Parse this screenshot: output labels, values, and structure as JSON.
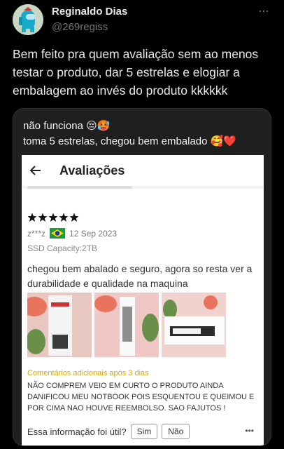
{
  "tweet": {
    "author_name": "Reginaldo Dias",
    "handle": "@269regiss",
    "more_icon": "⋯",
    "text": "Bem feito pra quem avaliação sem ao menos testar o produto, dar 5 estrelas e elogiar a embalagem ao invés do produto kkkkkk"
  },
  "caption": {
    "line1": "não funciona 😔🥵",
    "line2": "toma 5 estrelas, chegou bem embalado 🥰❤️"
  },
  "app": {
    "title": "Avaliações",
    "back_icon": "arrow-left-icon"
  },
  "review": {
    "rating": 5,
    "reviewer": "z***z",
    "date": "12 Sep 2023",
    "capacity": "SSD Capacity:2TB",
    "text": "chegou bem abalado e seguro, agora so resta ver a durabilidade e qualidade na maquina",
    "extra_title": "Comentários adicionais após 3 dias",
    "extra_text": "NÃO COMPREM VEIO EM CURTO O PRODUTO AINDA DANIFICOU MEU NOTBOOK POIS ESQUENTOU E QUEIMOU E POR CIMA NAO HOUVE REEMBOLSO. SAO FAJUTOS !",
    "feedback_question": "Essa informação foi útil?",
    "yes_label": "Sim",
    "no_label": "Não",
    "more_icon": "•••"
  },
  "colors": {
    "background": "#000000",
    "star": "#111111",
    "extra_title": "#e0a600"
  }
}
